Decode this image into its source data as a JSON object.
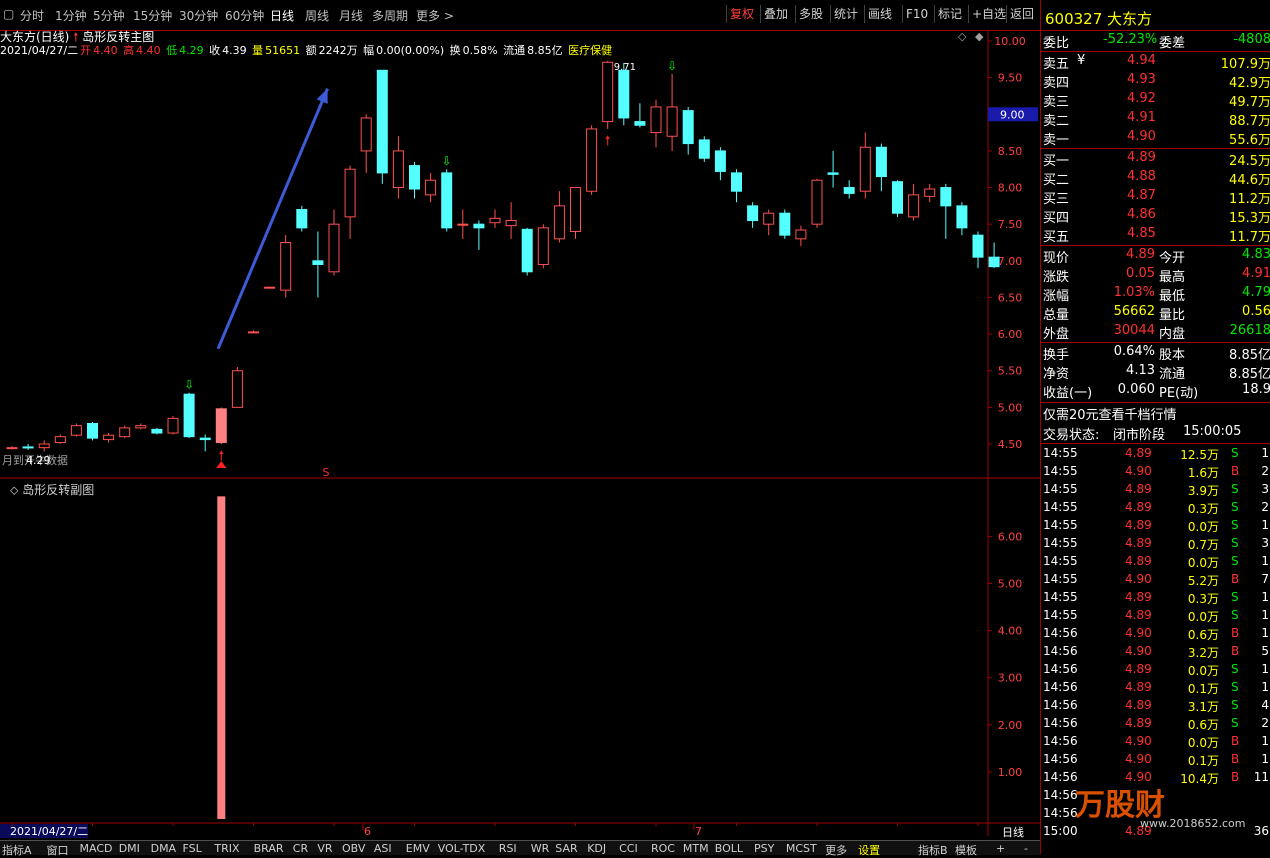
{
  "toolbar": {
    "left_tabs": [
      "分时",
      "1分钟",
      "5分钟",
      "15分钟",
      "30分钟",
      "60分钟",
      "日线",
      "周线",
      "月线",
      "多周期",
      "更多 >"
    ],
    "active_tab": "日线",
    "right_buttons": [
      "复权",
      "叠加",
      "多股",
      "统计",
      "画线",
      "F10",
      "标记",
      "+自选",
      "返回"
    ]
  },
  "chart": {
    "title_stock": "大东方(日线)",
    "title_formula": "岛形反转主图",
    "info": {
      "date": "2021/04/27/二",
      "open_label": "开",
      "open": "4.40",
      "high_label": "高",
      "high": "4.40",
      "low_label": "低",
      "low": "4.29",
      "close_label": "收",
      "close": "4.39",
      "vol_label": "量",
      "vol": "51651",
      "amt_label": "额",
      "amt": "2242万",
      "amp_label": "幅",
      "amp": "0.00(0.00%)",
      "turn_label": "换",
      "turn": "0.58%",
      "float_label": "流通",
      "float": "8.85亿",
      "sector": "医疗保健"
    },
    "price_axis": [
      "10.00",
      "9.50",
      "9.00",
      "8.50",
      "8.00",
      "7.50",
      "7.00",
      "6.50",
      "6.00",
      "5.50",
      "5.00",
      "4.50"
    ],
    "price_cursor": "9.00",
    "peak_label": "9.71",
    "low_marker_text": "4.29",
    "bottom_left_text": "月到开牛数据",
    "s_marker": "S",
    "sub_title": "岛形反转副图",
    "sub_axis": [
      "6.00",
      "5.00",
      "4.00",
      "3.00",
      "2.00",
      "1.00"
    ],
    "date_cursor": "2021/04/27/二",
    "month_labels": [
      "6",
      "7"
    ],
    "period_label": "日线"
  },
  "chart_data": {
    "type": "candlestick",
    "title": "岛形反转主图",
    "ylim": [
      4.2,
      10.1
    ],
    "candles": [
      {
        "o": 4.45,
        "c": 4.45,
        "h": 4.47,
        "l": 4.43
      },
      {
        "o": 4.46,
        "c": 4.45,
        "h": 4.5,
        "l": 4.42
      },
      {
        "o": 4.45,
        "c": 4.5,
        "h": 4.55,
        "l": 4.4
      },
      {
        "o": 4.52,
        "c": 4.6,
        "h": 4.63,
        "l": 4.5
      },
      {
        "o": 4.62,
        "c": 4.75,
        "h": 4.78,
        "l": 4.6
      },
      {
        "o": 4.78,
        "c": 4.58,
        "h": 4.8,
        "l": 4.55
      },
      {
        "o": 4.56,
        "c": 4.62,
        "h": 4.65,
        "l": 4.52
      },
      {
        "o": 4.6,
        "c": 4.72,
        "h": 4.75,
        "l": 4.58
      },
      {
        "o": 4.72,
        "c": 4.75,
        "h": 4.78,
        "l": 4.7
      },
      {
        "o": 4.7,
        "c": 4.65,
        "h": 4.72,
        "l": 4.63
      },
      {
        "o": 4.65,
        "c": 4.85,
        "h": 4.88,
        "l": 4.63
      },
      {
        "o": 5.18,
        "c": 4.6,
        "h": 5.2,
        "l": 4.58
      },
      {
        "o": 4.58,
        "c": 4.56,
        "h": 4.63,
        "l": 4.4
      },
      {
        "o": 4.52,
        "c": 4.98,
        "h": 5.0,
        "l": 4.5
      },
      {
        "o": 5.0,
        "c": 5.5,
        "h": 5.55,
        "l": 5.0
      },
      {
        "o": 6.03,
        "c": 6.03,
        "h": 6.05,
        "l": 6.02
      },
      {
        "o": 6.64,
        "c": 6.64,
        "h": 6.65,
        "l": 6.63
      },
      {
        "o": 6.6,
        "c": 7.25,
        "h": 7.35,
        "l": 6.5
      },
      {
        "o": 7.7,
        "c": 7.45,
        "h": 7.75,
        "l": 7.4
      },
      {
        "o": 7.0,
        "c": 6.95,
        "h": 7.4,
        "l": 6.5
      },
      {
        "o": 6.85,
        "c": 7.5,
        "h": 7.7,
        "l": 6.8
      },
      {
        "o": 7.6,
        "c": 8.25,
        "h": 8.3,
        "l": 7.3
      },
      {
        "o": 8.5,
        "c": 8.95,
        "h": 9.0,
        "l": 8.2
      },
      {
        "o": 9.6,
        "c": 8.2,
        "h": 9.6,
        "l": 8.05
      },
      {
        "o": 8.0,
        "c": 8.5,
        "h": 8.7,
        "l": 7.85
      },
      {
        "o": 8.3,
        "c": 7.98,
        "h": 8.35,
        "l": 7.85
      },
      {
        "o": 7.9,
        "c": 8.1,
        "h": 8.2,
        "l": 7.8
      },
      {
        "o": 8.2,
        "c": 7.45,
        "h": 8.25,
        "l": 7.4
      },
      {
        "o": 7.5,
        "c": 7.5,
        "h": 7.7,
        "l": 7.3
      },
      {
        "o": 7.5,
        "c": 7.45,
        "h": 7.55,
        "l": 7.15
      },
      {
        "o": 7.52,
        "c": 7.58,
        "h": 7.7,
        "l": 7.45
      },
      {
        "o": 7.48,
        "c": 7.55,
        "h": 7.8,
        "l": 7.3
      },
      {
        "o": 7.43,
        "c": 6.85,
        "h": 7.45,
        "l": 6.8
      },
      {
        "o": 6.95,
        "c": 7.45,
        "h": 7.5,
        "l": 6.9
      },
      {
        "o": 7.3,
        "c": 7.75,
        "h": 7.95,
        "l": 7.25
      },
      {
        "o": 7.4,
        "c": 8.0,
        "h": 8.0,
        "l": 7.3
      },
      {
        "o": 7.95,
        "c": 8.8,
        "h": 8.85,
        "l": 7.9
      },
      {
        "o": 8.9,
        "c": 9.71,
        "h": 9.73,
        "l": 8.8
      },
      {
        "o": 9.6,
        "c": 8.95,
        "h": 9.7,
        "l": 8.85
      },
      {
        "o": 8.9,
        "c": 8.85,
        "h": 9.15,
        "l": 8.82
      },
      {
        "o": 8.75,
        "c": 9.1,
        "h": 9.2,
        "l": 8.55
      },
      {
        "o": 8.7,
        "c": 9.1,
        "h": 9.55,
        "l": 8.5
      },
      {
        "o": 9.05,
        "c": 8.6,
        "h": 9.1,
        "l": 8.45
      },
      {
        "o": 8.65,
        "c": 8.4,
        "h": 8.7,
        "l": 8.35
      },
      {
        "o": 8.5,
        "c": 8.22,
        "h": 8.55,
        "l": 8.1
      },
      {
        "o": 8.2,
        "c": 7.95,
        "h": 8.25,
        "l": 7.8
      },
      {
        "o": 7.75,
        "c": 7.55,
        "h": 7.8,
        "l": 7.45
      },
      {
        "o": 7.5,
        "c": 7.65,
        "h": 7.7,
        "l": 7.35
      },
      {
        "o": 7.65,
        "c": 7.35,
        "h": 7.7,
        "l": 7.3
      },
      {
        "o": 7.3,
        "c": 7.42,
        "h": 7.48,
        "l": 7.2
      },
      {
        "o": 7.5,
        "c": 8.1,
        "h": 8.12,
        "l": 7.45
      },
      {
        "o": 8.2,
        "c": 8.18,
        "h": 8.5,
        "l": 8.0
      },
      {
        "o": 8.0,
        "c": 7.92,
        "h": 8.1,
        "l": 7.85
      },
      {
        "o": 7.95,
        "c": 8.55,
        "h": 8.75,
        "l": 7.85
      },
      {
        "o": 8.55,
        "c": 8.15,
        "h": 8.6,
        "l": 7.95
      },
      {
        "o": 8.08,
        "c": 7.65,
        "h": 8.1,
        "l": 7.6
      },
      {
        "o": 7.6,
        "c": 7.9,
        "h": 8.05,
        "l": 7.55
      },
      {
        "o": 7.88,
        "c": 7.98,
        "h": 8.05,
        "l": 7.8
      },
      {
        "o": 8.0,
        "c": 7.75,
        "h": 8.05,
        "l": 7.3
      },
      {
        "o": 7.75,
        "c": 7.45,
        "h": 7.8,
        "l": 7.35
      },
      {
        "o": 7.35,
        "c": 7.05,
        "h": 7.4,
        "l": 6.9
      },
      {
        "o": 7.05,
        "c": 6.92,
        "h": 7.25,
        "l": 6.9
      }
    ],
    "signals_down": [
      11,
      27,
      41
    ],
    "signals_up": [
      13,
      37
    ],
    "sub_chart": {
      "title": "岛形反转副图",
      "ylim": [
        0,
        7
      ],
      "bar_index": 13,
      "bar_value": 6.85
    }
  },
  "quote": {
    "code": "600327",
    "name": "大东方",
    "wb_label": "委比",
    "wb": "-52.23%",
    "wc_label": "委差",
    "wc": "-4808",
    "asks": [
      {
        "label": "卖五",
        "mark": "¥",
        "price": "4.94",
        "vol": "107.9万"
      },
      {
        "label": "卖四",
        "mark": "",
        "price": "4.93",
        "vol": "42.9万"
      },
      {
        "label": "卖三",
        "mark": "",
        "price": "4.92",
        "vol": "49.7万"
      },
      {
        "label": "卖二",
        "mark": "",
        "price": "4.91",
        "vol": "88.7万"
      },
      {
        "label": "卖一",
        "mark": "",
        "price": "4.90",
        "vol": "55.6万"
      }
    ],
    "bids": [
      {
        "label": "买一",
        "price": "4.89",
        "vol": "24.5万"
      },
      {
        "label": "买二",
        "price": "4.88",
        "vol": "44.6万"
      },
      {
        "label": "买三",
        "price": "4.87",
        "vol": "11.2万"
      },
      {
        "label": "买四",
        "price": "4.86",
        "vol": "15.3万"
      },
      {
        "label": "买五",
        "price": "4.85",
        "vol": "11.7万"
      }
    ],
    "stats": [
      {
        "l1": "现价",
        "v1": "4.89",
        "c1": "red",
        "l2": "今开",
        "v2": "4.83",
        "c2": "green"
      },
      {
        "l1": "涨跌",
        "v1": "0.05",
        "c1": "red",
        "l2": "最高",
        "v2": "4.91",
        "c2": "red"
      },
      {
        "l1": "涨幅",
        "v1": "1.03%",
        "c1": "red",
        "l2": "最低",
        "v2": "4.79",
        "c2": "green"
      },
      {
        "l1": "总量",
        "v1": "56662",
        "c1": "yellow",
        "l2": "量比",
        "v2": "0.56",
        "c2": "yellow"
      },
      {
        "l1": "外盘",
        "v1": "30044",
        "c1": "red",
        "l2": "内盘",
        "v2": "26618",
        "c2": "green"
      }
    ],
    "stats2": [
      {
        "l1": "换手",
        "v1": "0.64%",
        "l2": "股本",
        "v2": "8.85亿"
      },
      {
        "l1": "净资",
        "v1": "4.13",
        "l2": "流通",
        "v2": "8.85亿"
      },
      {
        "l1": "收益(一)",
        "v1": "0.060",
        "l2": "PE(动)",
        "v2": "18.9"
      }
    ],
    "promo": "仅需20元查看千档行情",
    "state_label": "交易状态:",
    "state": "闭市阶段",
    "state_time": "15:00:05"
  },
  "trades": [
    {
      "t": "14:55",
      "p": "4.89",
      "v": "12.5万",
      "s": "S",
      "n": "1"
    },
    {
      "t": "14:55",
      "p": "4.90",
      "v": "1.6万",
      "s": "B",
      "n": "2"
    },
    {
      "t": "14:55",
      "p": "4.89",
      "v": "3.9万",
      "s": "S",
      "n": "3"
    },
    {
      "t": "14:55",
      "p": "4.89",
      "v": "0.3万",
      "s": "S",
      "n": "2"
    },
    {
      "t": "14:55",
      "p": "4.89",
      "v": "0.0万",
      "s": "S",
      "n": "1"
    },
    {
      "t": "14:55",
      "p": "4.89",
      "v": "0.7万",
      "s": "S",
      "n": "3"
    },
    {
      "t": "14:55",
      "p": "4.89",
      "v": "0.0万",
      "s": "S",
      "n": "1"
    },
    {
      "t": "14:55",
      "p": "4.90",
      "v": "5.2万",
      "s": "B",
      "n": "7"
    },
    {
      "t": "14:55",
      "p": "4.89",
      "v": "0.3万",
      "s": "S",
      "n": "1"
    },
    {
      "t": "14:55",
      "p": "4.89",
      "v": "0.0万",
      "s": "S",
      "n": "1"
    },
    {
      "t": "14:56",
      "p": "4.90",
      "v": "0.6万",
      "s": "B",
      "n": "1"
    },
    {
      "t": "14:56",
      "p": "4.90",
      "v": "3.2万",
      "s": "B",
      "n": "5"
    },
    {
      "t": "14:56",
      "p": "4.89",
      "v": "0.0万",
      "s": "S",
      "n": "1"
    },
    {
      "t": "14:56",
      "p": "4.89",
      "v": "0.1万",
      "s": "S",
      "n": "1"
    },
    {
      "t": "14:56",
      "p": "4.89",
      "v": "3.1万",
      "s": "S",
      "n": "4"
    },
    {
      "t": "14:56",
      "p": "4.89",
      "v": "0.6万",
      "s": "S",
      "n": "2"
    },
    {
      "t": "14:56",
      "p": "4.90",
      "v": "0.0万",
      "s": "B",
      "n": "1"
    },
    {
      "t": "14:56",
      "p": "4.90",
      "v": "0.1万",
      "s": "B",
      "n": "1"
    },
    {
      "t": "14:56",
      "p": "4.90",
      "v": "10.4万",
      "s": "B",
      "n": "11"
    },
    {
      "t": "14:56",
      "p": "",
      "v": "",
      "s": "",
      "n": ""
    },
    {
      "t": "14:56",
      "p": "",
      "v": "",
      "s": "",
      "n": ""
    },
    {
      "t": "15:00",
      "p": "4.89",
      "v": "",
      "s": "",
      "n": "36"
    }
  ],
  "bottom_tabs": [
    "指标A",
    "窗口",
    "MACD",
    "DMI",
    "DMA",
    "FSL",
    "TRIX",
    "BRAR",
    "CR",
    "VR",
    "OBV",
    "ASI",
    "EMV",
    "VOL-TDX",
    "RSI",
    "WR",
    "SAR",
    "KDJ",
    "CCI",
    "ROC",
    "MTM",
    "BOLL",
    "PSY",
    "MCST",
    "更多",
    "设置"
  ],
  "bottom_tabs_right": [
    "指标B",
    "模板",
    "+",
    "-"
  ],
  "watermark": "万股财",
  "watermark_url": "www.2018652.com",
  "colors": {
    "up": "#ff5050",
    "down": "#54ffff",
    "grid": "#a00000",
    "arrow": "#3d5bd6",
    "sub_bar": "#ff8080"
  }
}
